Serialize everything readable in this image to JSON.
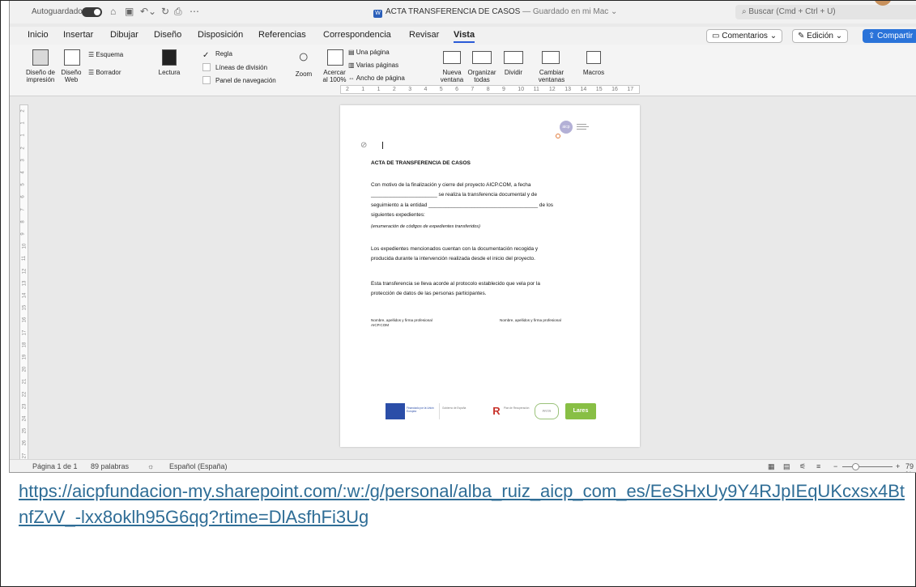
{
  "titlebar": {
    "autosave_label": "Autoguardado",
    "document_title": "ACTA TRANSFERENCIA DE CASOS",
    "save_status": "— Guardado en mi Mac ⌄",
    "search_placeholder": "Buscar (Cmd + Ctrl + U)"
  },
  "tabs": [
    "Inicio",
    "Insertar",
    "Dibujar",
    "Diseño",
    "Disposición",
    "Referencias",
    "Correspondencia",
    "Revisar",
    "Vista"
  ],
  "active_tab": "Vista",
  "tab_buttons": {
    "comments": "Comentarios",
    "editing": "Edición",
    "share": "Compartir"
  },
  "ribbon": {
    "print_layout": "Diseño de impresión",
    "print_layout_l1": "Diseño de",
    "print_layout_l2": "impresión",
    "web_layout_l1": "Diseño",
    "web_layout_l2": "Web",
    "outline": "Esquema",
    "draft": "Borrador",
    "reading": "Lectura",
    "ruler": "Regla",
    "gridlines": "Líneas de división",
    "nav_pane": "Panel de navegación",
    "zoom": "Zoom",
    "zoom100_l1": "Acercar",
    "zoom100_l2": "al 100%",
    "one_page": "Una página",
    "multiple_pages": "Varias páginas",
    "page_width": "Ancho de página",
    "new_window_l1": "Nueva",
    "new_window_l2": "ventana",
    "arrange_l1": "Organizar",
    "arrange_l2": "todas",
    "split": "Dividir",
    "switch_l1": "Cambiar",
    "switch_l2": "ventanas",
    "macros": "Macros"
  },
  "ruler_numbers": [
    "2",
    "1",
    "1",
    "2",
    "3",
    "4",
    "5",
    "6",
    "7",
    "8",
    "9",
    "10",
    "11",
    "12",
    "13",
    "14",
    "15",
    "16",
    "17"
  ],
  "vruler_numbers": [
    "2",
    "1",
    "1",
    "2",
    "3",
    "4",
    "5",
    "6",
    "7",
    "8",
    "9",
    "10",
    "11",
    "12",
    "13",
    "14",
    "15",
    "16",
    "17",
    "18",
    "19",
    "20",
    "21",
    "22",
    "23",
    "24",
    "25",
    "26",
    "27"
  ],
  "document": {
    "logo_text": "aicp",
    "title": "ACTA DE TRANSFERENCIA DE CASOS",
    "p1_l1": "Con motivo de la finalización y cierre del proyecto AICP.COM, a fecha",
    "p1_l2": "_______________________ se realiza la transferencia documental y de",
    "p1_l3": "seguimiento a la entidad ______________________________________ de los",
    "p1_l4": "siguientes expedientes:",
    "enumeration": "(enumeración de códigos de expedientes transferidos)",
    "p2_l1": "Los expedientes mencionados cuentan con la documentación recogida y",
    "p2_l2": "producida durante la intervención realizada desde el inicio del proyecto.",
    "p3_l1": "Esta transferencia se lleva acorde al protocolo establecido que vela por la",
    "p3_l2": "protección de datos de las personas participantes.",
    "sig_left_l1": "Nombre,  apellidos  y  firma  profesional",
    "sig_left_l2": "AICP.COM",
    "sig_right": "Nombre, apellidos y firma profesional",
    "footer_logos": [
      "Financiado por la Unión Europea",
      "Gobierno de España",
      "Plan de Recuperación",
      "PRTR",
      "Lares"
    ]
  },
  "statusbar": {
    "page": "Página 1 de 1",
    "words": "89 palabras",
    "language": "Español (España)",
    "zoom": "79 %"
  },
  "link_text": "https://aicpfundacion-my.sharepoint.com/:w:/g/personal/alba_ruiz_aicp_com_es/EeSHxUy9Y4RJpIEqUKcxsx4BtnfZvV_-lxx8oklh95G6qg?rtime=DlAsfhFi3Ug",
  "colors": {
    "accent": "#2a5bd7",
    "link": "#2f6d96",
    "share_button": "#2a73d9"
  }
}
